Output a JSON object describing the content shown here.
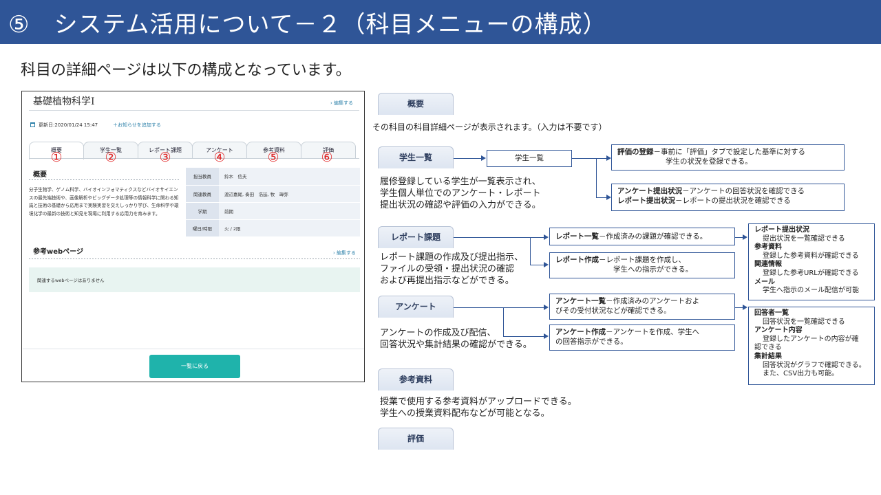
{
  "header": {
    "title": "⑤　システム活用について－２（科目メニューの構成）"
  },
  "subtitle": "科目の詳細ページは以下の構成となっています。",
  "screenshot": {
    "course_title": "基礎植物科学Ⅰ",
    "edit_link": "› 編集する",
    "updated": "更新日:2020/01/24 15:47",
    "add_notice": "＋お知らせを追加する",
    "tabs": [
      "概要",
      "学生一覧",
      "レポート課題",
      "アンケート",
      "参考資料",
      "評価"
    ],
    "tab_numbers": [
      "①",
      "②",
      "③",
      "④",
      "⑤",
      "⑥"
    ],
    "overview_heading": "概要",
    "overview_text": "分子生物学、ゲノム科学、バイオインフォマティクスなどバイオサイエンスの最先端技術や、画像解析やビッグデータ処理等の情報科学に関わる知識と技術の基礎から応用まで実験実習を交えしっかり学び、生命科学や環境化学の最新の技術と知見を現場に利用する応用力を育みます。",
    "info_rows": [
      {
        "key": "担当教員",
        "value": "鈴木　信夫"
      },
      {
        "key": "関連教員",
        "value": "渡辺嘉尾, 奏田　浩延, 牧　瑋弥"
      },
      {
        "key": "学期",
        "value": "前期"
      },
      {
        "key": "曜日/時限",
        "value": "火 / 2限"
      }
    ],
    "web_heading": "参考webページ",
    "web_edit_link": "› 編集する",
    "web_empty": "関連するwebページはありません",
    "back_button": "一覧に戻る"
  },
  "right": {
    "overview": {
      "label": "概要",
      "text": "その科目の科目詳細ページが表示されます。（入力は不要です）"
    },
    "students": {
      "label": "学生一覧",
      "text": [
        "履修登録している学生が一覧表示され、",
        "学生個人単位でのアンケート・レポート",
        "提出状況の確認や評価の入力ができる。"
      ],
      "box_list": "学生一覧",
      "box_eval_title": "評価の登録",
      "box_eval_text": "－事前に「評価」タブで設定した基準に対する",
      "box_eval_text2": "学生の状況を登録できる。",
      "box_status_title1": "アンケート提出状況",
      "box_status_text1": "－アンケートの回答状況を確認できる",
      "box_status_title2": "レポート提出状況",
      "box_status_text2": "－レポートの提出状況を確認できる"
    },
    "report": {
      "label": "レポート課題",
      "text": [
        "レポート課題の作成及び提出指示、",
        "ファイルの受領・提出状況の確認",
        "および再提出指示などができる。"
      ],
      "box_list_title": "レポート一覧",
      "box_list_text": "－作成済みの課題が確認できる。",
      "box_create_title": "レポート作成",
      "box_create_text": "－レポート課題を作成し、",
      "box_create_text2": "学生への指示ができる。",
      "detail": [
        {
          "title": "レポート提出状況",
          "text": "提出状況を一覧確認できる"
        },
        {
          "title": "参考資料",
          "text": "登録した参考資料が確認できる"
        },
        {
          "title": "関連情報",
          "text": "登録した参考URLが確認できる"
        },
        {
          "title": "メール",
          "text": "学生へ指示のメール配信が可能"
        }
      ]
    },
    "survey": {
      "label": "アンケート",
      "text": [
        "アンケートの作成及び配信、",
        "回答状況や集計結果の確認ができる。"
      ],
      "box_list_title": "アンケート一覧",
      "box_list_text": "－作成済みのアンケートおよ",
      "box_list_text2": "びその受付状況などが確認できる。",
      "box_create_title": "アンケート作成",
      "box_create_text": "－アンケートを作成、学生へ",
      "box_create_text2": "の回答指示ができる。",
      "detail": [
        {
          "title": "回答者一覧",
          "text": "回答状況を一覧確認できる"
        },
        {
          "title": "アンケート内容",
          "text": "登録したアンケートの内容が確",
          "text2": "認できる"
        },
        {
          "title": "集計結果",
          "text": "回答状況がグラフで確認できる。",
          "text2": "また、CSV出力も可能。"
        }
      ]
    },
    "materials": {
      "label": "参考資料",
      "text": [
        "授業で使用する参考資料がアップロードできる。",
        "学生への授業資料配布などが可能となる。"
      ]
    },
    "grading": {
      "label": "評価"
    }
  },
  "colors": {
    "header_bg": "#2f5597",
    "accent_teal": "#1fb3ab",
    "number_red": "#e02020",
    "link_blue": "#2a7fa8"
  }
}
